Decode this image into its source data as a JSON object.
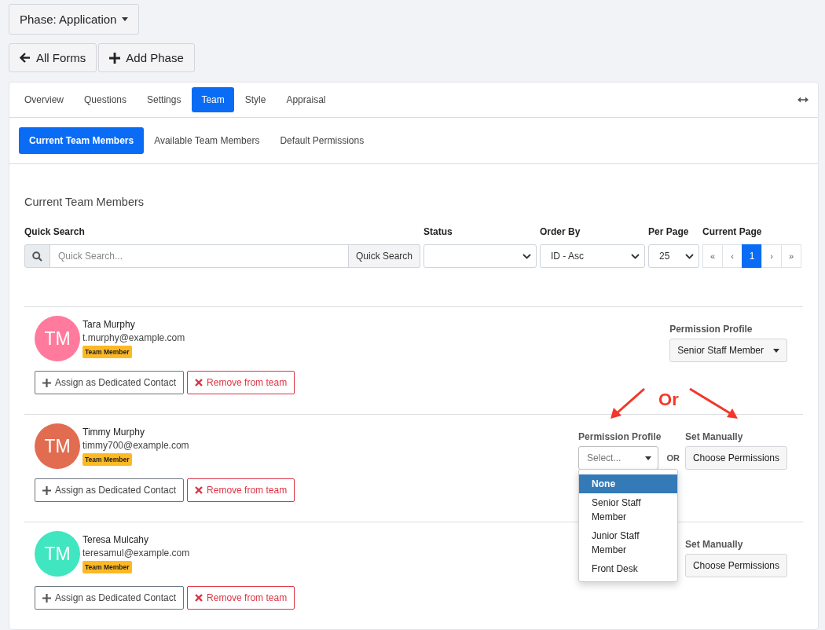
{
  "phase_button": {
    "label": "Phase: Application"
  },
  "nav_buttons": [
    {
      "kind": "back",
      "label": "All Forms"
    },
    {
      "kind": "add",
      "label": "Add Phase"
    }
  ],
  "tabs": [
    {
      "label": "Overview",
      "selected": false
    },
    {
      "label": "Questions",
      "selected": false
    },
    {
      "label": "Settings",
      "selected": false
    },
    {
      "label": "Team",
      "selected": true
    },
    {
      "label": "Style",
      "selected": false
    },
    {
      "label": "Appraisal",
      "selected": false
    }
  ],
  "subtabs": [
    {
      "label": "Current Team Members",
      "selected": true
    },
    {
      "label": "Available Team Members",
      "selected": false
    },
    {
      "label": "Default Permissions",
      "selected": false
    }
  ],
  "section_title": "Current Team Members",
  "filters": {
    "quick_search": {
      "label": "Quick Search",
      "placeholder": "Quick Search...",
      "button": "Quick Search"
    },
    "status": {
      "label": "Status"
    },
    "order_by": {
      "label": "Order By",
      "value": "ID - Asc"
    },
    "per_page": {
      "label": "Per Page",
      "value": "25"
    },
    "current_page": {
      "label": "Current Page",
      "pages": [
        {
          "label": "«",
          "selected": false
        },
        {
          "label": "‹",
          "selected": false
        },
        {
          "label": "1",
          "selected": true
        },
        {
          "label": "›",
          "selected": false
        },
        {
          "label": "»",
          "selected": false
        }
      ]
    }
  },
  "members": [
    {
      "initials": "TM",
      "color": "#ff7a9c",
      "name": "Tara Murphy",
      "email": "t.murphy@example.com",
      "badge": "Team Member",
      "assign_button": "Assign as Dedicated Contact",
      "remove_button": "Remove from team",
      "permission": {
        "kind": "profile",
        "profile_label": "Permission Profile",
        "profile_value": "Senior Staff Member"
      }
    },
    {
      "initials": "TM",
      "color": "#e26c50",
      "name": "Timmy Murphy",
      "email": "timmy700@example.com",
      "badge": "Team Member",
      "assign_button": "Assign as Dedicated Contact",
      "remove_button": "Remove from team",
      "permission": {
        "kind": "profile_or_manual",
        "profile_label": "Permission Profile",
        "placeholder": "Select...",
        "or_label": "OR",
        "manual_label": "Set Manually",
        "manual_button": "Choose Permissions",
        "dropdown_open": true,
        "options": [
          {
            "label": "None",
            "selected": true
          },
          {
            "label": "Senior Staff Member",
            "selected": false
          },
          {
            "label": "Junior Staff Member",
            "selected": false
          },
          {
            "label": "Front Desk",
            "selected": false
          }
        ]
      },
      "annotation": {
        "text": "Or"
      }
    },
    {
      "initials": "TM",
      "color": "#3fe6bf",
      "name": "Teresa Mulcahy",
      "email": "teresamul@example.com",
      "badge": "Team Member",
      "assign_button": "Assign as Dedicated Contact",
      "remove_button": "Remove from team",
      "permission": {
        "kind": "manual",
        "manual_label": "Set Manually",
        "manual_button": "Choose Permissions"
      }
    }
  ]
}
